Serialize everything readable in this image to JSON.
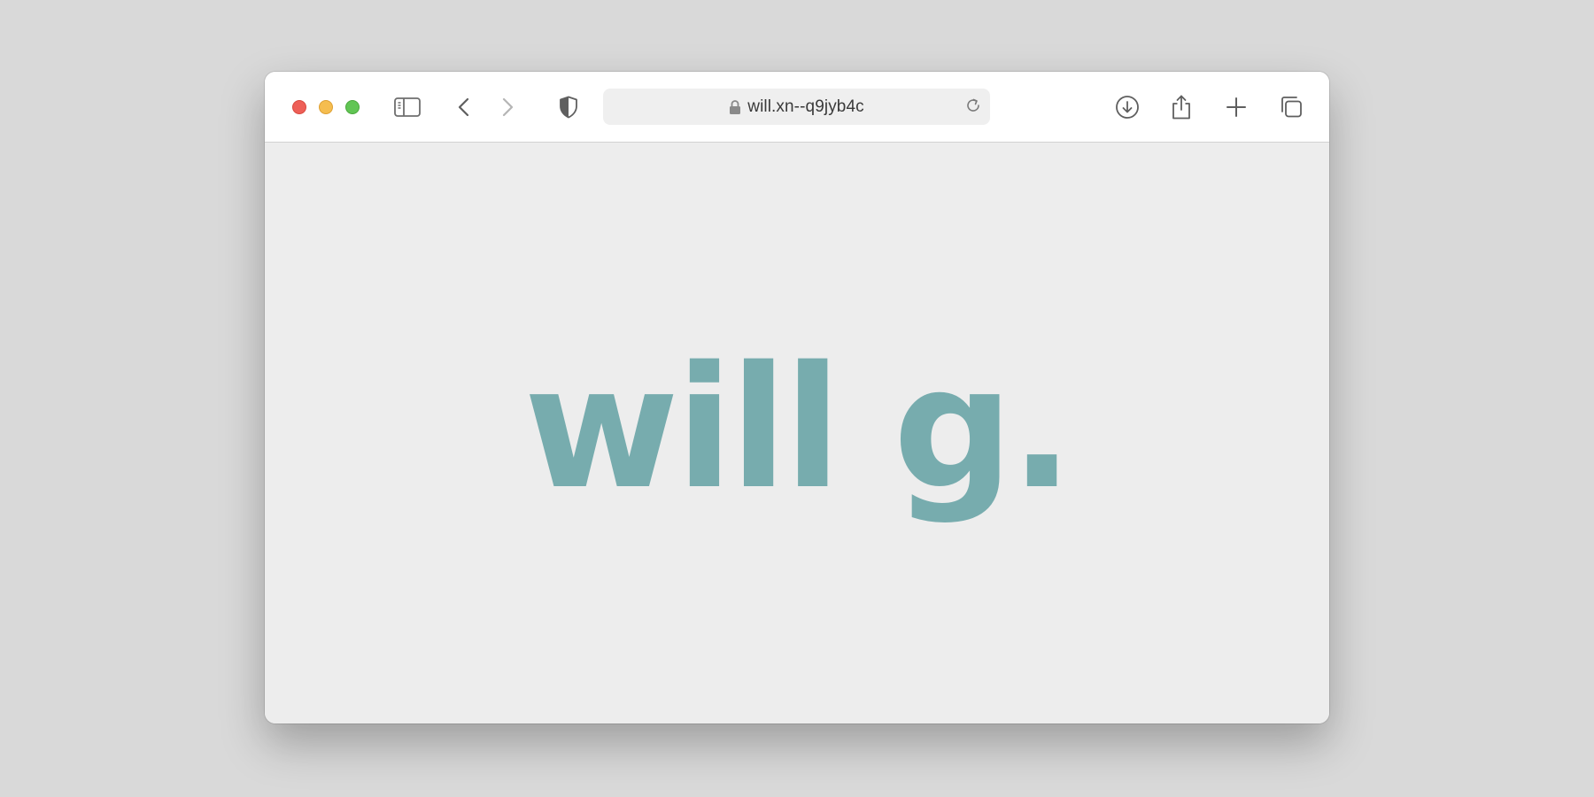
{
  "browser": {
    "address_bar": {
      "url": "will.xn--q9jyb4c"
    },
    "toolbar_icons": [
      "sidebar-icon",
      "back-icon",
      "forward-icon",
      "shield-icon",
      "lock-icon",
      "reload-icon",
      "download-icon",
      "share-icon",
      "new-tab-icon",
      "tabs-overview-icon"
    ]
  },
  "page": {
    "heading": "will g."
  },
  "colors": {
    "heading": "#77acae",
    "page_background": "#ededed",
    "desktop_background": "#d9d9d9",
    "close": "#ee5f57",
    "minimize": "#f5bd4f",
    "zoom": "#61c554"
  }
}
